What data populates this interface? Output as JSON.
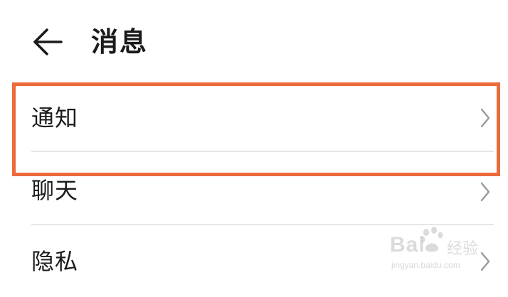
{
  "header": {
    "back_icon": "arrow-left-icon",
    "title": "消息"
  },
  "list": {
    "items": [
      {
        "label": "通知",
        "icon": "chevron-right-icon"
      },
      {
        "label": "聊天",
        "icon": "chevron-right-icon"
      },
      {
        "label": "隐私",
        "icon": "chevron-right-icon"
      }
    ]
  },
  "annotation": {
    "highlight_color": "#ec6a3c",
    "highlighted_item": "通知"
  },
  "watermark": {
    "logo": "Bai",
    "brand_cn": "经验",
    "url": "jingyan.baidu.com"
  }
}
